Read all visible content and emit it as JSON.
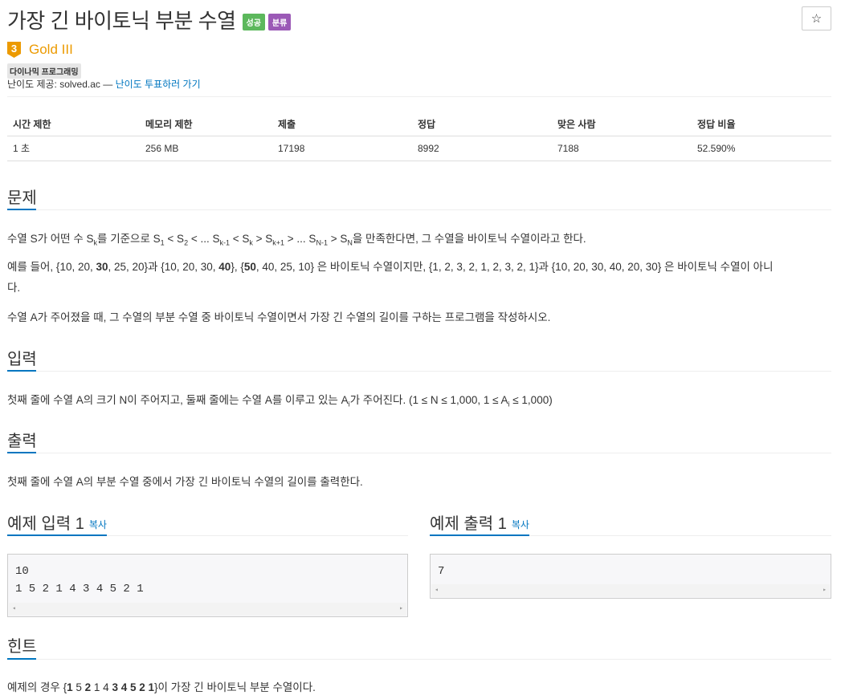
{
  "problem": {
    "title": "가장 긴 바이토닉 부분 수열",
    "badges": {
      "success": "성공",
      "category": "분류"
    },
    "star": "☆",
    "tier_number": "3",
    "tier_name": "Gold III",
    "algorithm_tag": "다이나믹 프로그래밍",
    "credit_prefix": "난이도 제공: solved.ac —",
    "credit_link": "난이도 투표하러 가기"
  },
  "info_table": {
    "headers": [
      "시간 제한",
      "메모리 제한",
      "제출",
      "정답",
      "맞은 사람",
      "정답 비율"
    ],
    "values": [
      "1 초",
      "256 MB",
      "17198",
      "8992",
      "7188",
      "52.590%"
    ]
  },
  "sections": {
    "problem": "문제",
    "input": "입력",
    "output": "출력",
    "hint": "힌트"
  },
  "description": {
    "line1": {
      "a": "수열 S가 어떤 수 S",
      "sub_k": "k",
      "b": "를 기준으로 S",
      "sub_1": "1",
      "c": " < S",
      "sub_2": "2",
      "d": " < ... S",
      "sub_k1": "k-1",
      "e": " < S",
      "sub_k_b": "k",
      "f": " > S",
      "sub_kp1": "k+1",
      "g": " > ... S",
      "sub_n1": "N-1",
      "h": " > S",
      "sub_n": "N",
      "i": "을 만족한다면, 그 수열을 바이토닉 수열이라고 한다."
    },
    "line2": {
      "a": "예를 들어, {10, 20, ",
      "b1": "30",
      "c": ", 25, 20}과 {10, 20, 30, ",
      "b2": "40",
      "d": "}, {",
      "b3": "50",
      "e": ", 40, 25, 10} 은 바이토닉 수열이지만,  {1, 2, 3, 2, 1, 2, 3, 2, 1}과 {10, 20, 30, 40, 20, 30} 은 바이토닉 수열이 아니",
      "f": "다."
    },
    "line3": "수열 A가 주어졌을 때, 그 수열의 부분 수열 중 바이토닉 수열이면서 가장 긴 수열의 길이를 구하는 프로그램을 작성하시오."
  },
  "input_desc": {
    "a": "첫째 줄에 수열 A의 크기 N이 주어지고, 둘째 줄에는 수열 A를 이루고 있는 A",
    "sub_i": "i",
    "b": "가 주어진다. (1 ≤ N ≤ 1,000, 1 ≤ A",
    "sub_i2": "i",
    "c": " ≤ 1,000)"
  },
  "output_desc": "첫째 줄에 수열 A의 부분 수열 중에서 가장 긴 바이토닉 수열의 길이를 출력한다.",
  "samples": {
    "input_title": "예제 입력 1",
    "output_title": "예제 출력 1",
    "copy_label": "복사",
    "input_lines": [
      "10",
      "1 5 2 1 4 3 4 5 2 1"
    ],
    "output_lines": [
      "7"
    ],
    "scroll_left": "◂",
    "scroll_right": "▸"
  },
  "hint": {
    "a": "예제의 경우 {",
    "b1": "1",
    "c": " 5 ",
    "b2": "2",
    "d": " 1 4 ",
    "b3": "3 4 5 2 1",
    "e": "}이 가장 긴 바이토닉 부분 수열이다."
  }
}
